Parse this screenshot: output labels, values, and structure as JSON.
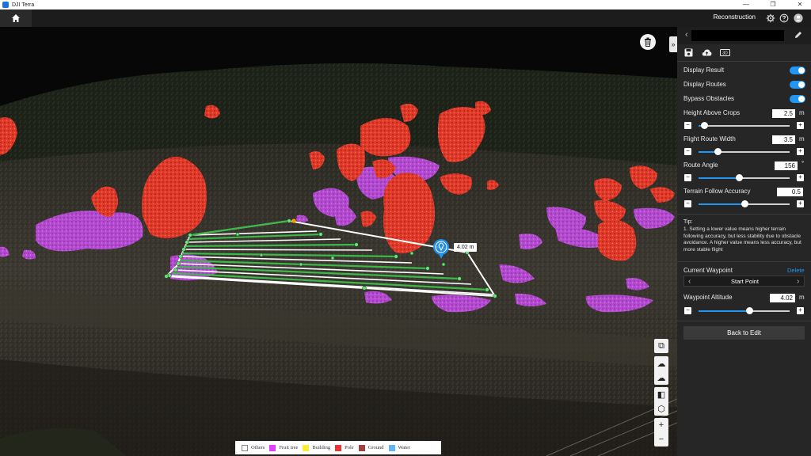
{
  "window": {
    "title": "DJI Terra"
  },
  "topbar": {
    "title": "Reconstruction",
    "icons": [
      "gear-icon",
      "help-icon",
      "user-icon"
    ]
  },
  "viewport": {
    "distance_label": "4.02 m",
    "legend": [
      {
        "label": "Others",
        "color": "#ffffff"
      },
      {
        "label": "Fruit tree",
        "color": "#e040fb"
      },
      {
        "label": "Building",
        "color": "#ffeb3b"
      },
      {
        "label": "Pole",
        "color": "#e53935"
      },
      {
        "label": "Ground",
        "color": "#a04040"
      },
      {
        "label": "Water",
        "color": "#64b5f6"
      }
    ],
    "tools": {
      "zoom_in": "+",
      "zoom_out": "−"
    }
  },
  "panel": {
    "route_name": "",
    "toggles": {
      "display_result": {
        "label": "Display Result",
        "on": true
      },
      "display_routes": {
        "label": "Display Routes",
        "on": true
      },
      "bypass_obstacles": {
        "label": "Bypass Obstacles",
        "on": true
      }
    },
    "params": {
      "height_above_crops": {
        "label": "Height Above Crops",
        "value": "2.5",
        "unit": "m",
        "level": 0.06
      },
      "flight_route_width": {
        "label": "Flight Route Width",
        "value": "3.5",
        "unit": "m",
        "level": 0.21
      },
      "route_angle": {
        "label": "Route Angle",
        "value": "156",
        "unit": "°",
        "level": 0.44
      },
      "terrain_follow_accuracy": {
        "label": "Terrain Follow Accuracy",
        "value": "0.5",
        "unit": "",
        "level": 0.5
      }
    },
    "tip": {
      "title": "Tip:",
      "text": "1. Setting a lower value means higher terrain following accuracy, but less stability due to obstacle avoidance. A higher value means less accuracy, but more stable flight"
    },
    "waypoint": {
      "label": "Current Waypoint",
      "delete_label": "Delete",
      "selected": "Start Point",
      "altitude_label": "Waypoint Altitude",
      "altitude_value": "4.02",
      "altitude_unit": "m",
      "altitude_level": 0.56
    },
    "back_to_edit": "Back to Edit"
  },
  "colors": {
    "accent": "#2196f3",
    "route_line": "#4caf50",
    "tree": "#e53935",
    "crop": "#b040d0"
  }
}
